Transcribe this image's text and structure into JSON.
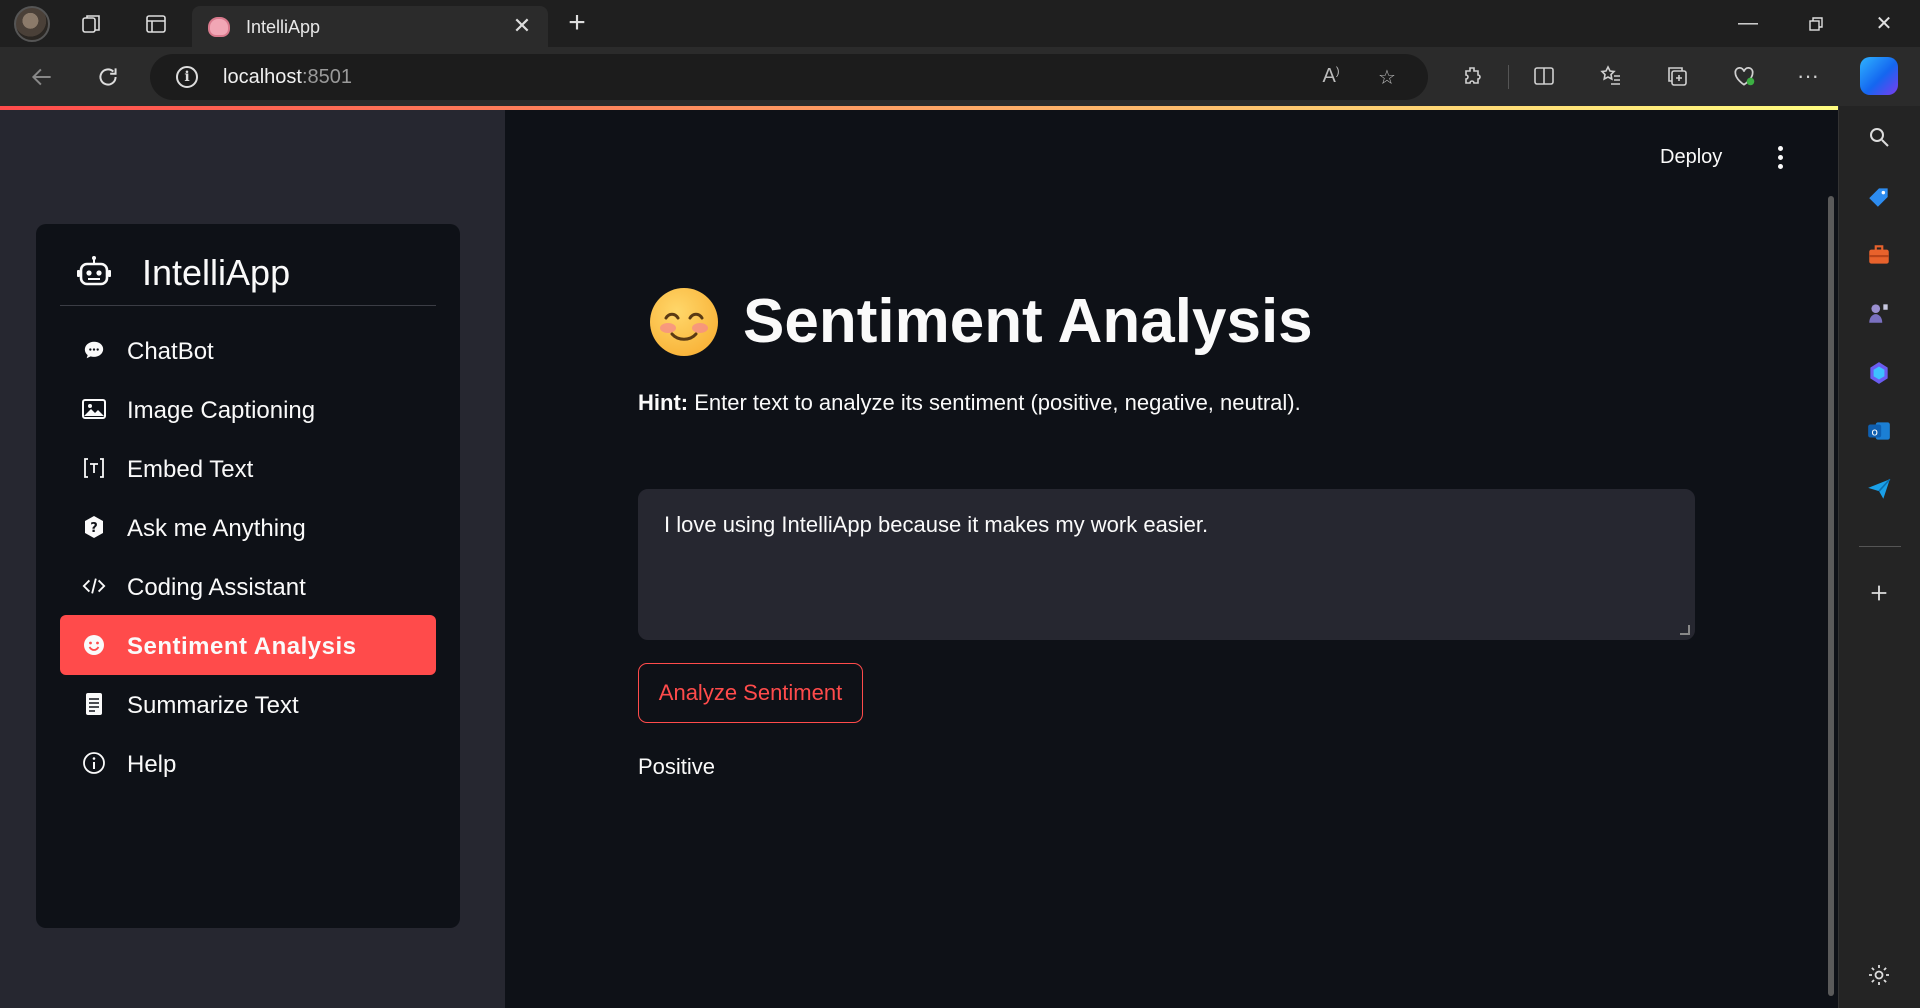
{
  "browser": {
    "tab_title": "IntelliApp",
    "url_host": "localhost",
    "url_port": ":8501"
  },
  "app": {
    "deploy_label": "Deploy",
    "menu_title": "IntelliApp",
    "menu_items": [
      {
        "label": "ChatBot",
        "icon": "chat-icon"
      },
      {
        "label": "Image Captioning",
        "icon": "image-icon"
      },
      {
        "label": "Embed Text",
        "icon": "text-embed-icon"
      },
      {
        "label": "Ask me Anything",
        "icon": "question-icon"
      },
      {
        "label": "Coding Assistant",
        "icon": "code-icon"
      },
      {
        "label": "Sentiment Analysis",
        "icon": "smile-icon",
        "active": true
      },
      {
        "label": "Summarize Text",
        "icon": "document-icon"
      },
      {
        "label": "Help",
        "icon": "info-icon"
      }
    ]
  },
  "main": {
    "title": "Sentiment Analysis",
    "hint_label": "Hint:",
    "hint_text": " Enter text to analyze its sentiment (positive, negative, neutral).",
    "input_value": "I love using IntelliApp because it makes my work easier.",
    "button_label": "Analyze Sentiment",
    "result": "Positive"
  },
  "colors": {
    "accent": "#ff4b4b",
    "background": "#0e1117",
    "sidebar": "#262730"
  }
}
